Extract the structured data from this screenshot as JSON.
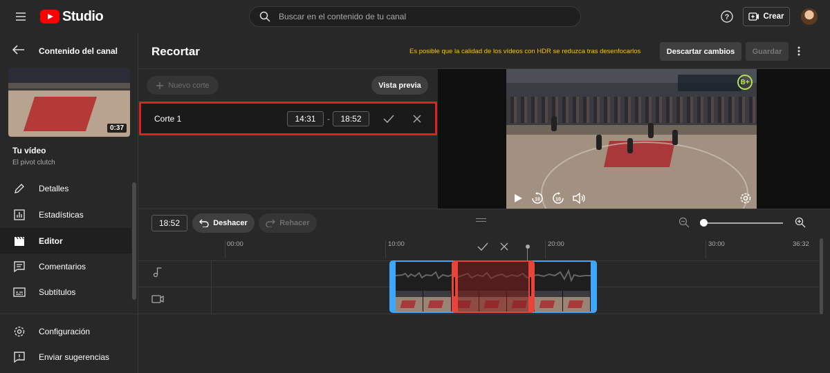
{
  "topbar": {
    "logo_text": "Studio",
    "search_placeholder": "Buscar en el contenido de tu canal",
    "create_label": "Crear"
  },
  "sidebar": {
    "title": "Contenido del canal",
    "thumbnail_duration": "0:37",
    "your_video_label": "Tu vídeo",
    "video_name": "El pivot clutch",
    "items": [
      {
        "label": "Detalles",
        "icon": "pencil-icon"
      },
      {
        "label": "Estadísticas",
        "icon": "analytics-icon"
      },
      {
        "label": "Editor",
        "icon": "clapperboard-icon",
        "active": true
      },
      {
        "label": "Comentarios",
        "icon": "comment-icon"
      },
      {
        "label": "Subtítulos",
        "icon": "subtitles-icon"
      }
    ],
    "bottom_items": [
      {
        "label": "Configuración",
        "icon": "gear-icon"
      },
      {
        "label": "Enviar sugerencias",
        "icon": "feedback-icon"
      }
    ]
  },
  "header": {
    "title": "Recortar",
    "warning": "Es posible que la calidad de los vídeos con HDR se reduzca tras desenfocarlos",
    "discard_label": "Descartar cambios",
    "save_label": "Guardar"
  },
  "cuts": {
    "new_cut_label": "Nuevo corte",
    "preview_label": "Vista previa",
    "items": [
      {
        "label": "Corte 1",
        "start": "14:31",
        "end": "18:52"
      }
    ]
  },
  "video": {
    "badge": "B+"
  },
  "timeline": {
    "current_time": "18:52",
    "undo_label": "Deshacer",
    "redo_label": "Rehacer",
    "ruler": [
      "00:00",
      "10:00",
      "20:00",
      "30:00",
      "36:32"
    ]
  },
  "colors": {
    "accent_blue": "#3ea6ff",
    "cut_red": "#e8443a",
    "highlight_border": "#e41e26",
    "warning_yellow": "#f9c20f"
  }
}
